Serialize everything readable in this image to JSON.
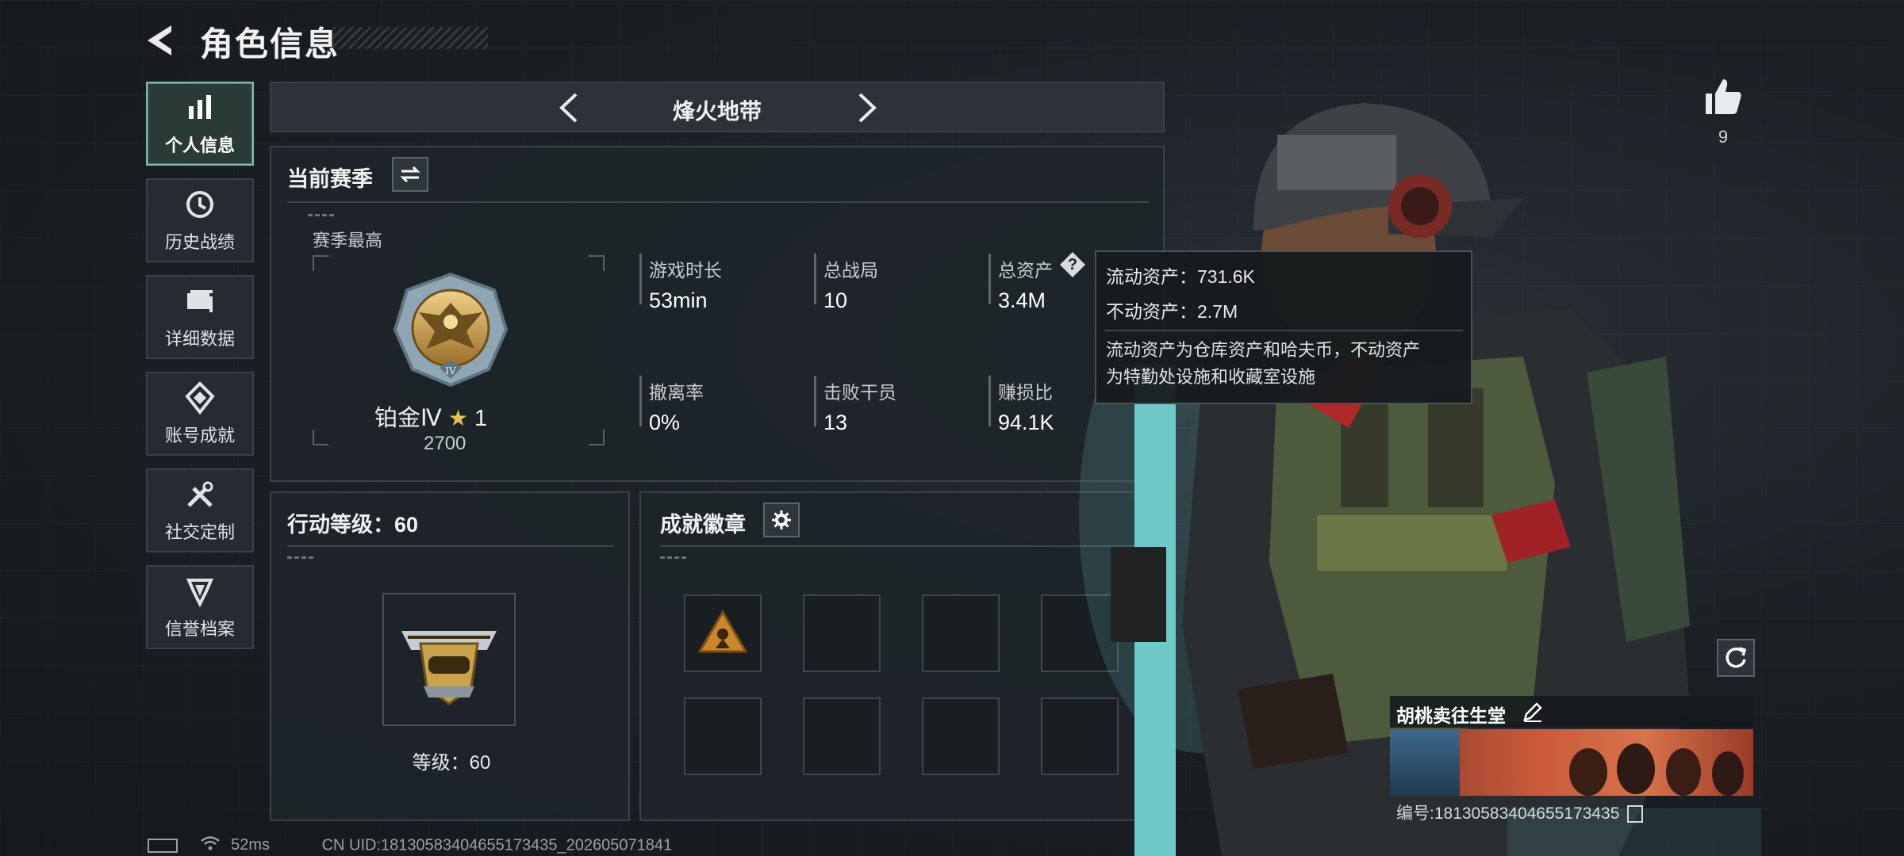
{
  "header": {
    "title": "角色信息"
  },
  "sidebar": {
    "items": [
      {
        "label": "个人信息",
        "icon": "bar-chart-icon",
        "active": true
      },
      {
        "label": "历史战绩",
        "icon": "clock-icon"
      },
      {
        "label": "详细数据",
        "icon": "folder-icon"
      },
      {
        "label": "账号成就",
        "icon": "achievement-icon"
      },
      {
        "label": "社交定制",
        "icon": "tools-icon"
      },
      {
        "label": "信誉档案",
        "icon": "shield-icon"
      }
    ]
  },
  "mode_selector": {
    "title": "烽火地带"
  },
  "season": {
    "title": "当前赛季",
    "best_label": "赛季最高",
    "rank_name": "铂金Ⅳ",
    "stars": "1",
    "rank_points": "2700",
    "rank_roman": "IV",
    "stats": [
      {
        "label": "游戏时长",
        "value": "53min"
      },
      {
        "label": "总战局",
        "value": "10"
      },
      {
        "label": "总资产",
        "value": "3.4M"
      },
      {
        "label": "撤离率",
        "value": "0%"
      },
      {
        "label": "击败干员",
        "value": "13"
      },
      {
        "label": "赚损比",
        "value": "94.1K"
      }
    ]
  },
  "tooltip": {
    "liquid": "流动资产：731.6K",
    "fixed": "不动资产：2.7M",
    "note_line1": "流动资产为仓库资产和哈夫币，不动资产",
    "note_line2": "为特勤处设施和收藏室设施"
  },
  "action_level": {
    "title": "行动等级：60",
    "level_text": "等级：60"
  },
  "achievements": {
    "title": "成就徽章",
    "slots": 8,
    "filled": 1
  },
  "profile": {
    "likes": "9",
    "name": "胡桃卖往生堂",
    "id_text": "编号:1813058340465517​3435"
  },
  "status": {
    "ping": "52ms",
    "uid": "CN UID:1813058340465517​3435_202605071841"
  },
  "colors": {
    "accent": "#7fb9a8",
    "gold": "#c9a24a",
    "panel": "#1e2429"
  }
}
